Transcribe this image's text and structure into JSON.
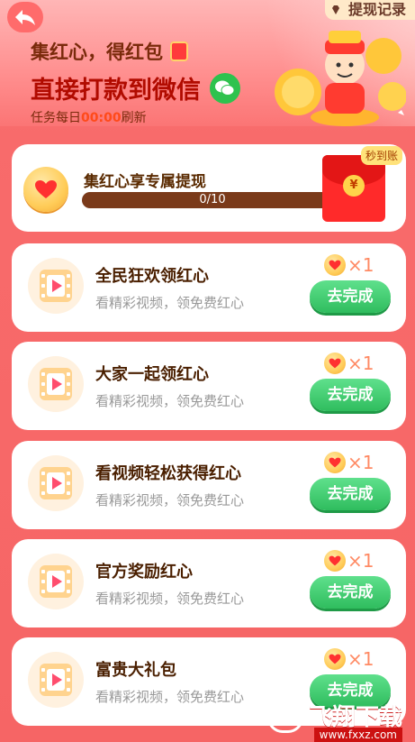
{
  "header": {
    "history_label": "提现记录",
    "title_line1": "集红心，得红包",
    "title_line2": "直接打款到微信",
    "refresh_prefix": "任务每日",
    "refresh_time": "00:00",
    "refresh_suffix": "刷新"
  },
  "withdraw_card": {
    "title": "集红心享专属提现",
    "progress_text": "0/10",
    "progress_fraction": 0,
    "badge": "秒到账",
    "envelope_symbol": "¥"
  },
  "tasks": [
    {
      "title": "全民狂欢领红心",
      "subtitle": "看精彩视频，领免费红心",
      "reward": "×1",
      "button": "去完成"
    },
    {
      "title": "大家一起领红心",
      "subtitle": "看精彩视频，领免费红心",
      "reward": "×1",
      "button": "去完成"
    },
    {
      "title": "看视频轻松获得红心",
      "subtitle": "看精彩视频，领免费红心",
      "reward": "×1",
      "button": "去完成"
    },
    {
      "title": "官方奖励红心",
      "subtitle": "看精彩视频，领免费红心",
      "reward": "×1",
      "button": "去完成"
    },
    {
      "title": "富贵大礼包",
      "subtitle": "看精彩视频，领免费红心",
      "reward": "×1",
      "button": "去完成"
    }
  ],
  "watermark": {
    "text": "飞翔下载",
    "url": "www.fxxz.com"
  },
  "colors": {
    "accent": "#f66565",
    "button_green": "#2fbd5e",
    "title_brown": "#4a1f00"
  }
}
